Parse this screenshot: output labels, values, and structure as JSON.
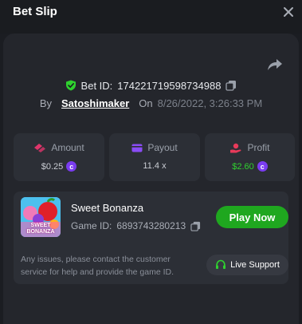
{
  "header": {
    "title": "Bet Slip"
  },
  "bet": {
    "id_label": "Bet ID:",
    "id_value": "174221719598734988",
    "by_label": "By",
    "username": "Satoshimaker",
    "on_label": "On",
    "date": "8/26/2022, 3:26:33 PM"
  },
  "stats": {
    "amount": {
      "label": "Amount",
      "value": "$0.25"
    },
    "payout": {
      "label": "Payout",
      "value": "11.4 x"
    },
    "profit": {
      "label": "Profit",
      "value": "$2.60"
    }
  },
  "game": {
    "name": "Sweet Bonanza",
    "thumb_text_1": "SWEET",
    "thumb_text_2": "BONANZA",
    "id_label": "Game ID:",
    "id_value": "6893743280213",
    "play_label": "Play Now",
    "help_text": "Any issues, please contact the customer service for help and provide the game ID.",
    "live_support_label": "Live Support"
  },
  "colors": {
    "background": "#1b1d22",
    "panel": "#24262c",
    "card": "#2c2f36",
    "accent_green": "#1fa71f",
    "profit_green": "#2fd12f",
    "coin_purple": "#7a3cf0",
    "stat_icon_pink": "#e0356b",
    "stat_icon_purple": "#8a4cf5",
    "stat_icon_red": "#e83a5a"
  },
  "icons": {
    "close": "close-icon",
    "share": "share-icon",
    "shield": "shield-check-icon",
    "copy": "copy-icon",
    "amount": "bet-chips-icon",
    "payout": "wallet-icon",
    "profit": "hand-coin-icon",
    "coin": "coin-icon",
    "headset": "headset-icon"
  }
}
